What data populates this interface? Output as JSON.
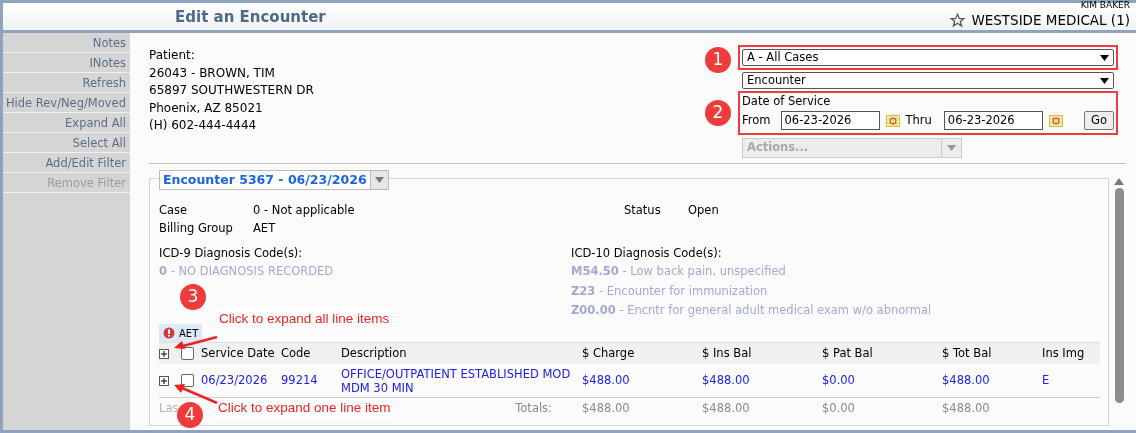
{
  "header": {
    "title": "Edit an Encounter",
    "user": "KIM BAKER",
    "practice": "WESTSIDE MEDICAL (1)"
  },
  "sidebar": {
    "items": [
      {
        "label": "Notes",
        "disabled": false
      },
      {
        "label": "INotes",
        "disabled": false
      },
      {
        "label": "Refresh",
        "disabled": false
      },
      {
        "label": "Hide Rev/Neg/Moved",
        "disabled": false
      },
      {
        "label": "Expand All",
        "disabled": false
      },
      {
        "label": "Select All",
        "disabled": false
      },
      {
        "label": "Add/Edit Filter",
        "disabled": false
      },
      {
        "label": "Remove Filter",
        "disabled": true
      }
    ]
  },
  "patient": {
    "label": "Patient:",
    "lines": [
      "26043 - BROWN, TIM",
      "65897 SOUTHWESTERN DR",
      "Phoenix, AZ 85021",
      "(H) 602-444-4444"
    ]
  },
  "filters": {
    "case_select": "A - All Cases",
    "type_select": "Encounter",
    "date_label": "Date of Service",
    "from_label": "From",
    "from_value": "06-23-2026",
    "thru_label": "Thru",
    "thru_value": "06-23-2026",
    "go_button": "Go",
    "actions": {
      "label": "Actions...",
      "disabled": true
    }
  },
  "encounter": {
    "title": "Encounter 5367 - 06/23/2026",
    "fields": [
      {
        "label": "Case",
        "value": "0 - Not applicable"
      },
      {
        "label": "Billing Group",
        "value": "AET"
      }
    ],
    "status": {
      "label": "Status",
      "value": "Open"
    },
    "icd9": {
      "label": "ICD-9 Diagnosis Code(s):",
      "codes": [
        "**0** - NO DIAGNOSIS RECORDED"
      ]
    },
    "icd10": {
      "label": "ICD-10 Diagnosis Code(s):",
      "codes": [
        "**M54.50** - Low back pain, unspecified",
        "**Z23** - Encounter for immunization",
        "**Z00.00** - Encntr for general adult medical exam w/o abnormal"
      ]
    },
    "payer_tab": "AET",
    "table": {
      "columns": [
        "Service Date",
        "Code",
        "Description",
        "$ Charge",
        "$ Ins Bal",
        "$ Pat Bal",
        "$ Tot Bal",
        "Ins Img"
      ],
      "header_checked": false,
      "rows": [
        {
          "checked": false,
          "service_date": "06/23/2026",
          "code": "99214",
          "description": "OFFICE/OUTPATIENT ESTABLISHED MOD MDM 30 MIN",
          "charge": "$488.00",
          "ins_bal": "$488.00",
          "pat_bal": "$0.00",
          "tot_bal": "$488.00",
          "ins_img": "E"
        }
      ],
      "footer_left": "Las",
      "totals_label": "Totals:",
      "totals": [
        "$488.00",
        "$488.00",
        "$0.00",
        "$488.00"
      ]
    }
  },
  "callouts": [
    {
      "number": "1"
    },
    {
      "number": "2"
    },
    {
      "number": "3",
      "text": "Click to expand all line items"
    },
    {
      "number": "4",
      "text": "Click to expand one line item"
    }
  ]
}
